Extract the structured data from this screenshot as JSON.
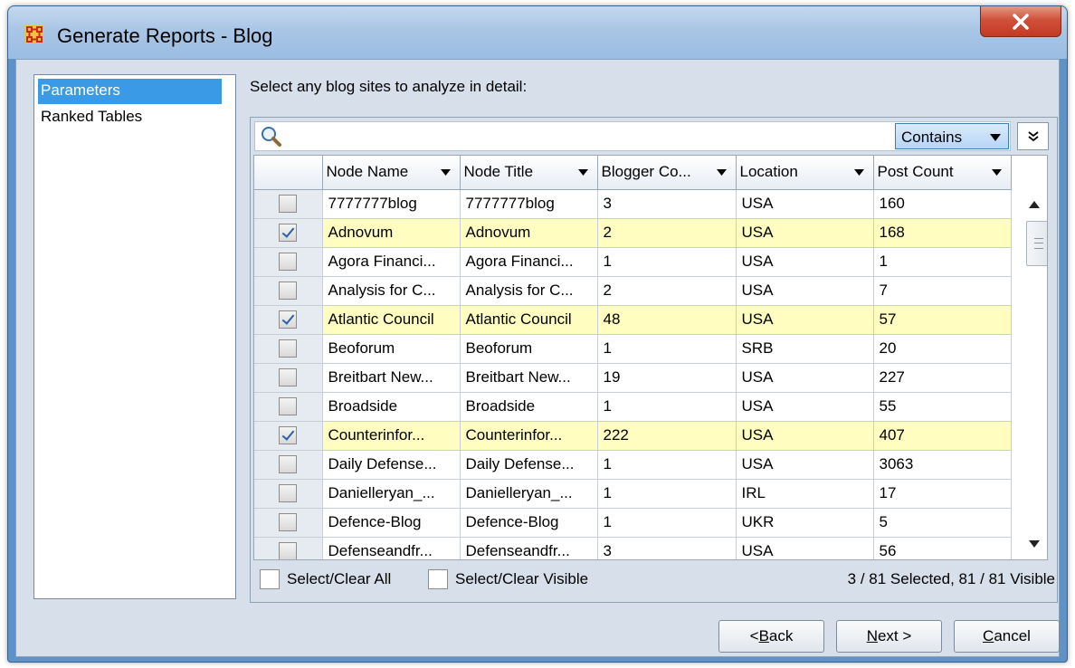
{
  "window": {
    "title": "Generate Reports - Blog",
    "close_glyph": "X"
  },
  "nav": {
    "items": [
      "Parameters",
      "Ranked Tables"
    ],
    "selected_index": 0
  },
  "prompt": "Select any blog sites to analyze in detail:",
  "search": {
    "value": "",
    "match_mode": "Contains"
  },
  "table": {
    "columns": [
      "Node Name",
      "Node Title",
      "Blogger Co...",
      "Location",
      "Post Count"
    ],
    "rows": [
      {
        "checked": false,
        "cells": [
          "7777777blog",
          "7777777blog",
          "3",
          "USA",
          "160"
        ]
      },
      {
        "checked": true,
        "cells": [
          "Adnovum",
          "Adnovum",
          "2",
          "USA",
          "168"
        ]
      },
      {
        "checked": false,
        "cells": [
          "Agora Financi...",
          "Agora Financi...",
          "1",
          "USA",
          "1"
        ]
      },
      {
        "checked": false,
        "cells": [
          "Analysis for C...",
          "Analysis for C...",
          "2",
          "USA",
          "7"
        ]
      },
      {
        "checked": true,
        "cells": [
          "Atlantic Council",
          "Atlantic Council",
          "48",
          "USA",
          "57"
        ]
      },
      {
        "checked": false,
        "cells": [
          "Beoforum",
          "Beoforum",
          "1",
          "SRB",
          "20"
        ]
      },
      {
        "checked": false,
        "cells": [
          "Breitbart New...",
          "Breitbart New...",
          "19",
          "USA",
          "227"
        ]
      },
      {
        "checked": false,
        "cells": [
          "Broadside",
          "Broadside",
          "1",
          "USA",
          "55"
        ]
      },
      {
        "checked": true,
        "cells": [
          "Counterinfor...",
          "Counterinfor...",
          "222",
          "USA",
          "407"
        ]
      },
      {
        "checked": false,
        "cells": [
          "Daily Defense...",
          "Daily Defense...",
          "1",
          "USA",
          "3063"
        ]
      },
      {
        "checked": false,
        "cells": [
          "Danielleryan_...",
          "Danielleryan_...",
          "1",
          "IRL",
          "17"
        ]
      },
      {
        "checked": false,
        "cells": [
          "Defence-Blog",
          "Defence-Blog",
          "1",
          "UKR",
          "5"
        ]
      },
      {
        "checked": false,
        "cells": [
          "Defenseandfr...",
          "Defenseandfr...",
          "3",
          "USA",
          "56"
        ]
      }
    ]
  },
  "footer": {
    "select_all_label": "Select/Clear All",
    "select_visible_label": "Select/Clear Visible",
    "status": "3 / 81 Selected, 81 / 81 Visible"
  },
  "buttons": {
    "back": {
      "prefix": "< ",
      "mnemonic": "B",
      "rest": "ack"
    },
    "next": {
      "mnemonic": "N",
      "rest": "ext >"
    },
    "cancel": {
      "mnemonic": "C",
      "rest": "ancel"
    }
  },
  "colors": {
    "selected_nav": "#3a9ae6",
    "checked_row": "#fffdc0",
    "close_button": "#c43a24"
  }
}
